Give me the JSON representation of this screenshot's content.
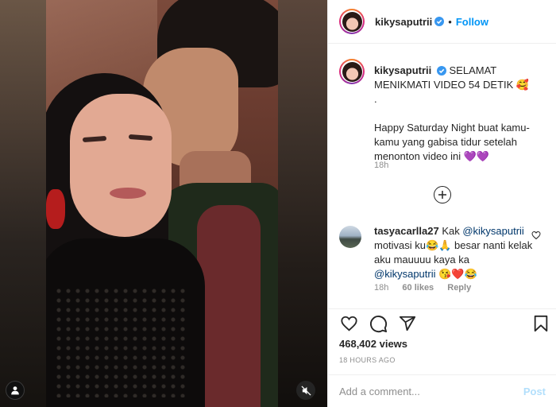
{
  "header": {
    "username": "kikysaputrii",
    "separator": "•",
    "follow_label": "Follow"
  },
  "caption": {
    "username": "kikysaputrii",
    "line1": "SELAMAT MENIKMATI VIDEO 54 DETIK 🥰",
    "line2": ".",
    "line3": "Happy Saturday Night buat kamu-kamu yang gabisa tidur setelah menonton video ini 💜💜",
    "time": "18h"
  },
  "comment": {
    "username": "tasyacarlla27",
    "prefix": "Kak ",
    "mention1": "@kikysaputrii",
    "middle": " motivasi ku😂🙏 besar nanti kelak aku mauuuu kaya ka ",
    "mention2": "@kikysaputrii",
    "suffix": " 😘❤️😂",
    "time": "18h",
    "likes": "60 likes",
    "reply": "Reply"
  },
  "stats": {
    "views": "468,402 views",
    "timestamp": "18 HOURS AGO"
  },
  "composer": {
    "placeholder": "Add a comment...",
    "post_label": "Post"
  },
  "icons": {
    "like": "heart-icon",
    "comment": "comment-icon",
    "share": "share-icon",
    "save": "bookmark-icon",
    "new_comments": "plus-circle-icon",
    "tagged_people": "person-icon",
    "muted": "speaker-muted-icon",
    "verified": "verified-badge-icon"
  },
  "colors": {
    "accent": "#0095f6",
    "verified": "#3897f0",
    "post_disabled": "#b2dffc",
    "muted_text": "#8e8e8e"
  }
}
